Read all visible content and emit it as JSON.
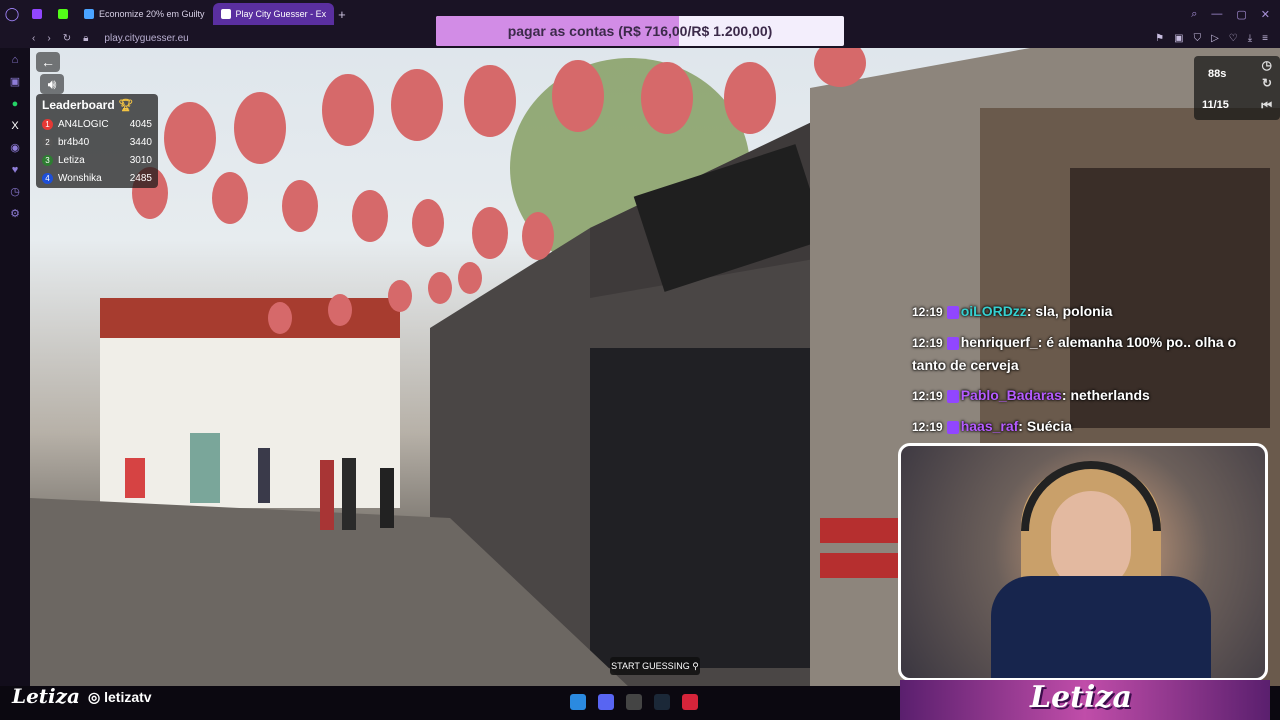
{
  "browser": {
    "tabs": [
      {
        "label": "Economize 20% em Guilty",
        "active": false
      },
      {
        "label": "Play City Guesser - Ex",
        "active": true
      }
    ],
    "new_tab": "+",
    "url": "play.cityguesser.eu"
  },
  "donation_goal": {
    "text": "pagar as contas (R$ 716,00/R$ 1.200,00)",
    "current": 716,
    "target": 1200
  },
  "game": {
    "leaderboard": {
      "title": "Leaderboard",
      "entries": [
        {
          "rank": "1",
          "name": "AN4LOGIC",
          "score": "4045",
          "color": "#e53935"
        },
        {
          "rank": "2",
          "name": "br4b40",
          "score": "3440",
          "color": "#555555"
        },
        {
          "rank": "3",
          "name": "Letiza",
          "score": "3010",
          "color": "#2e7d32"
        },
        {
          "rank": "4",
          "name": "Wonshika",
          "score": "2485",
          "color": "#1e4fd8"
        }
      ]
    },
    "timer": "88s",
    "round": "11/15",
    "start_guessing": "START GUESSING"
  },
  "chat": [
    {
      "time": "12:19",
      "user": "oiLORDzz",
      "user_color": "#35d0d0",
      "message": "sla, polonia"
    },
    {
      "time": "12:19",
      "user": "henriquerf_",
      "user_color": "#ffffff",
      "message": "é alemanha 100% po.. olha o tanto de cerveja"
    },
    {
      "time": "12:19",
      "user": "Pablo_Badaras",
      "user_color": "#b55cff",
      "message": "netherlands"
    },
    {
      "time": "12:19",
      "user": "haas_raf",
      "user_color": "#b55cff",
      "message": "Suécia"
    }
  ],
  "branding": {
    "logo": "Letiza",
    "handle": "letizatv",
    "overlay_name": "Letiza"
  },
  "colors": {
    "accent": "#9146ff",
    "goal_fill": "#d28ce6"
  }
}
